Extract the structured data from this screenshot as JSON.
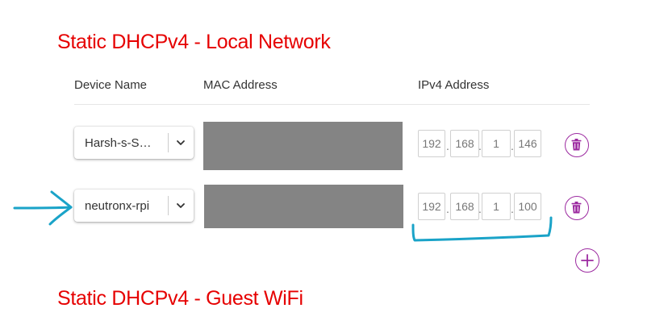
{
  "sections": {
    "local_title": "Static DHCPv4 - Local Network",
    "guest_title": "Static DHCPv4 - Guest WiFi"
  },
  "table": {
    "headers": {
      "device": "Device Name",
      "mac": "MAC Address",
      "ipv4": "IPv4 Address"
    },
    "rows": [
      {
        "device_name": "Harsh-s-S…",
        "ip": [
          "192",
          "168",
          "1",
          "146"
        ]
      },
      {
        "device_name": "neutronx-rpi",
        "ip": [
          "192",
          "168",
          "1",
          "100"
        ]
      }
    ]
  },
  "ip_separator": ".",
  "icons": {
    "dropdown": "chevron-down-icon",
    "delete": "trash-icon",
    "add": "plus-icon"
  },
  "colors": {
    "title": "#e60000",
    "action": "#9c2aa0",
    "redaction": "#848484",
    "annotation": "#1aa3c8"
  }
}
